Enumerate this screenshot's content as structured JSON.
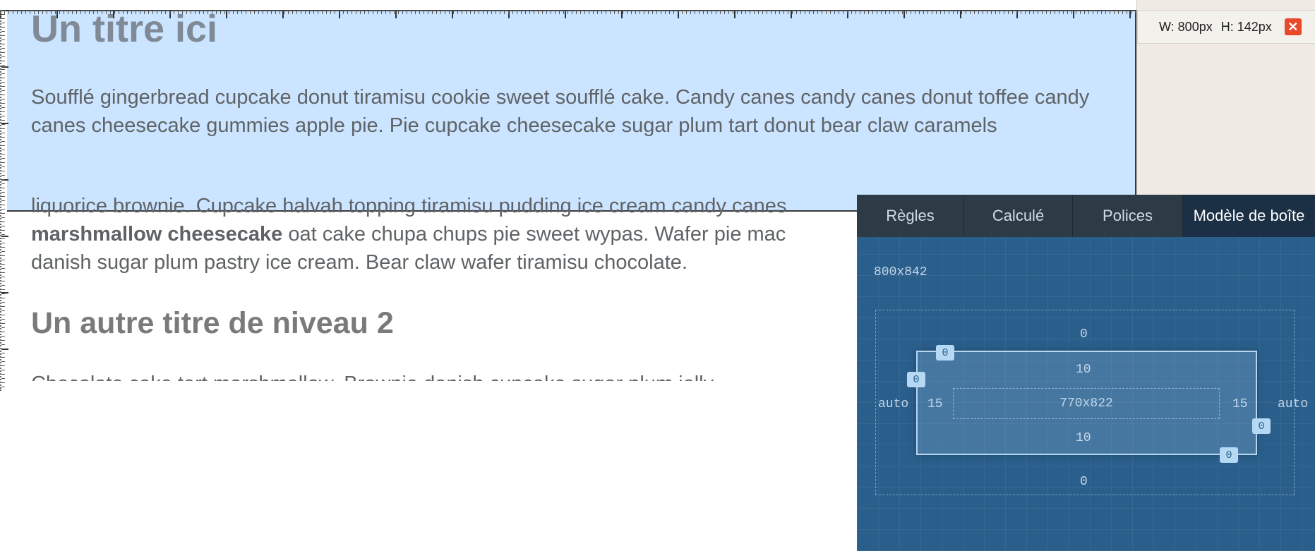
{
  "webpage": {
    "heading1": "Un titre ici",
    "paragraph1": "Soufflé gingerbread cupcake donut tiramisu cookie sweet soufflé cake. Candy canes candy canes donut toffee candy canes cheesecake gummies apple pie. Pie cupcake cheesecake sugar plum tart donut bear claw caramels",
    "paragraph2_start": "liquorice brownie. Cupcake halvah topping tiramisu pudding ice cream candy canes",
    "paragraph2_bold": "marshmallow cheesecake",
    "paragraph2_mid": " oat cake chupa chups pie sweet wypas. Wafer pie mac",
    "paragraph2_end": "danish sugar plum pastry ice cream. Bear claw wafer tiramisu chocolate.",
    "heading2": "Un autre titre de niveau 2",
    "paragraph3": "Chocolate cake tart marshmallow. Brownie danish cupcake sugar plum jelly"
  },
  "selection": {
    "width_label": "W: 800px",
    "height_label": "H: 142px",
    "close_icon": "close-icon",
    "highlight_color": "#afd5ff"
  },
  "devtools": {
    "tabs": [
      "Règles",
      "Calculé",
      "Polices",
      "Modèle de boîte"
    ],
    "active_tab": "Modèle de boîte",
    "element_size": "800x842",
    "margin": {
      "top": "0",
      "bottom": "0",
      "left": "auto",
      "right": "auto"
    },
    "border": {
      "top": "0",
      "left": "0",
      "right": "0",
      "bottom": "0"
    },
    "padding": {
      "top": "10",
      "bottom": "10",
      "left": "15",
      "right": "15"
    },
    "content_size": "770x822",
    "panel_color": "#2a5f8c"
  }
}
